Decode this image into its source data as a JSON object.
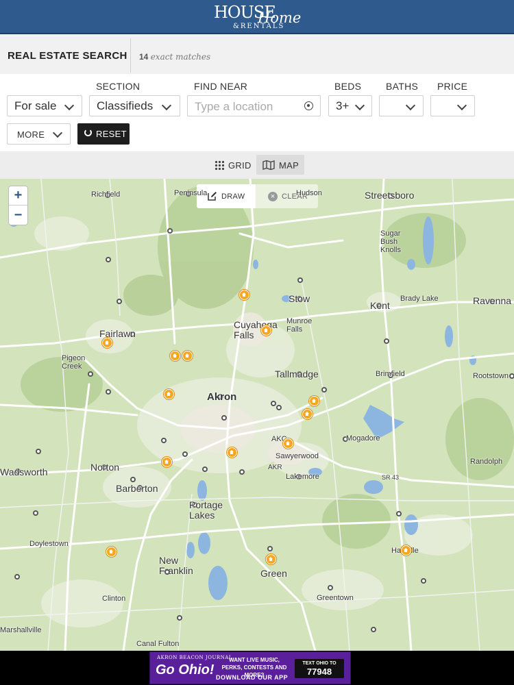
{
  "header": {
    "logo_line1": "HOUSE",
    "logo_line2": "Home",
    "logo_line3": "&RENTALS"
  },
  "search": {
    "title": "REAL ESTATE SEARCH",
    "match_count": "14",
    "match_suffix": "exact matches"
  },
  "filters": {
    "listing_type": "For sale",
    "section_label": "SECTION",
    "section_value": "Classifieds",
    "find_near_label": "FIND NEAR",
    "find_near_placeholder": "Type a location",
    "beds_label": "BEDS",
    "beds_value": "3+",
    "baths_label": "BATHS",
    "baths_value": "",
    "price_label": "PRICE",
    "price_value": "",
    "more_label": "MORE",
    "reset_label": "RESET"
  },
  "view": {
    "grid_label": "GRID",
    "map_label": "MAP",
    "active": "map"
  },
  "map": {
    "zoom_in": "+",
    "zoom_out": "−",
    "draw_label": "DRAW",
    "clear_label": "CLEAR",
    "places": {
      "richfield": "Richfield",
      "peninsula": "Peninsula",
      "hudson": "Hudson",
      "streetsboro": "Streetsboro",
      "sugar_bush_knolls": "Sugar Bush Knolls",
      "stow": "Stow",
      "brady_lake": "Brady Lake",
      "kent": "Kent",
      "ravenna": "Ravenna",
      "cuyahoga_falls": "Cuyahoga Falls",
      "munroe_falls": "Munroe Falls",
      "fairlawn": "Fairlawn",
      "pigeon_creek": "Pigeon Creek",
      "tallmadge": "Tallmadge",
      "brimfield": "Brimfield",
      "rootstown": "Rootstown",
      "akron": "Akron",
      "akron_canton_airport": "AKC",
      "mogadore": "Mogadore",
      "sawyerwood": "Sawyerwood",
      "akr": "AKR",
      "lakemore": "Lakemore",
      "randolph": "Randolph",
      "wadsworth": "Wadsworth",
      "norton": "Norton",
      "barberton": "Barberton",
      "portage_lakes": "Portage Lakes",
      "sr43": "SR 43",
      "doylestown": "Doylestown",
      "new_franklin": "New Franklin",
      "green": "Green",
      "greentown": "Greentown",
      "hartville": "Hartville",
      "clinton": "Clinton",
      "marshallville": "Marshallville",
      "canal_fulton": "Canal Fulton"
    },
    "listing_pins": 14
  },
  "ad": {
    "publisher": "AKRON BEACON JOURNAL",
    "brand": "Go Ohio!",
    "line1": "WANT LIVE MUSIC, PERKS, CONTESTS AND MORE?",
    "line2": "DOWNLOAD OUR APP",
    "text_prefix": "TEXT OHIO TO",
    "text_number": "77948"
  },
  "colors": {
    "header_bg": "#2f5a8d",
    "pin": "#f5a623",
    "map_land": "#cfe0b6",
    "ad_bg": "#5a1f9a"
  }
}
